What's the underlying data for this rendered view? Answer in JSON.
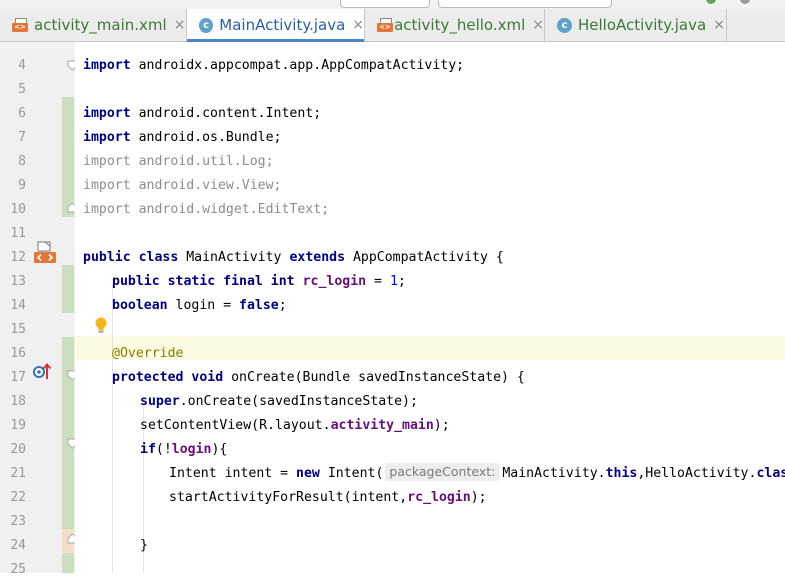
{
  "tabs": [
    {
      "label": "activity_main.xml",
      "type": "xml",
      "active": false,
      "color": "#3c7a35"
    },
    {
      "label": "MainActivity.java",
      "type": "class",
      "active": true,
      "color": "#2a5ea8"
    },
    {
      "label": "activity_hello.xml",
      "type": "xml",
      "active": false,
      "color": "#3c7a35"
    },
    {
      "label": "HelloActivity.java",
      "type": "class",
      "active": false,
      "color": "#3c7a35"
    }
  ],
  "tab_close_glyph": "×",
  "gutter": {
    "line_numbers": [
      "4",
      "5",
      "6",
      "7",
      "8",
      "9",
      "10",
      "11",
      "12",
      "13",
      "14",
      "15",
      "16",
      "17",
      "18",
      "19",
      "20",
      "21",
      "22",
      "23",
      "24",
      "25"
    ],
    "icons": {
      "line_12": "layout-file-icon",
      "line_15": "intention-bulb-icon",
      "line_17": "override-method-icon"
    }
  },
  "code": {
    "l4": {
      "kw": "import",
      "text": " androidx.appcompat.app.AppCompatActivity;"
    },
    "l6": {
      "kw": "import",
      "text": " android.content.Intent;"
    },
    "l7": {
      "kw": "import",
      "text": " android.os.Bundle;"
    },
    "l8": {
      "kw": "import",
      "text": " android.util.Log;"
    },
    "l9": {
      "kw": "import",
      "text": " android.view.View;"
    },
    "l10": {
      "kw": "import",
      "text": " android.widget.EditText;"
    },
    "l12": {
      "kw1": "public class",
      "name": " MainActivity ",
      "kw2": "extends",
      "text": " AppCompatActivity {"
    },
    "l13": {
      "kw": "public static final int",
      "sp": " ",
      "field": "rc_login",
      "eq": " = ",
      "num": "1",
      "end": ";"
    },
    "l14": {
      "kw": "boolean",
      "text": " login = ",
      "kw2": "false",
      "end": ";"
    },
    "l16": {
      "anno": "@Override"
    },
    "l17": {
      "kw": "protected void",
      "text": " onCreate(Bundle savedInstanceState) {"
    },
    "l18": {
      "kw": "super",
      "text": ".onCreate(savedInstanceState);"
    },
    "l19": {
      "text": "setContentView(R.layout.",
      "field": "activity_main",
      "end": ");"
    },
    "l20": {
      "kw": "if",
      "text": "(!",
      "field": "login",
      "end": "){"
    },
    "l21": {
      "pre": "Intent intent = ",
      "kw": "new",
      "mid": " Intent(",
      "hint": "packageContext:",
      "post1": "MainActivity.",
      "kw2": "this",
      "post2": ",HelloActivity.",
      "kw3": "class",
      "end": ");"
    },
    "l22": {
      "text": "startActivityForResult(intent,",
      "field": "rc_login",
      "end": ");"
    },
    "l24": {
      "text": "}"
    }
  }
}
